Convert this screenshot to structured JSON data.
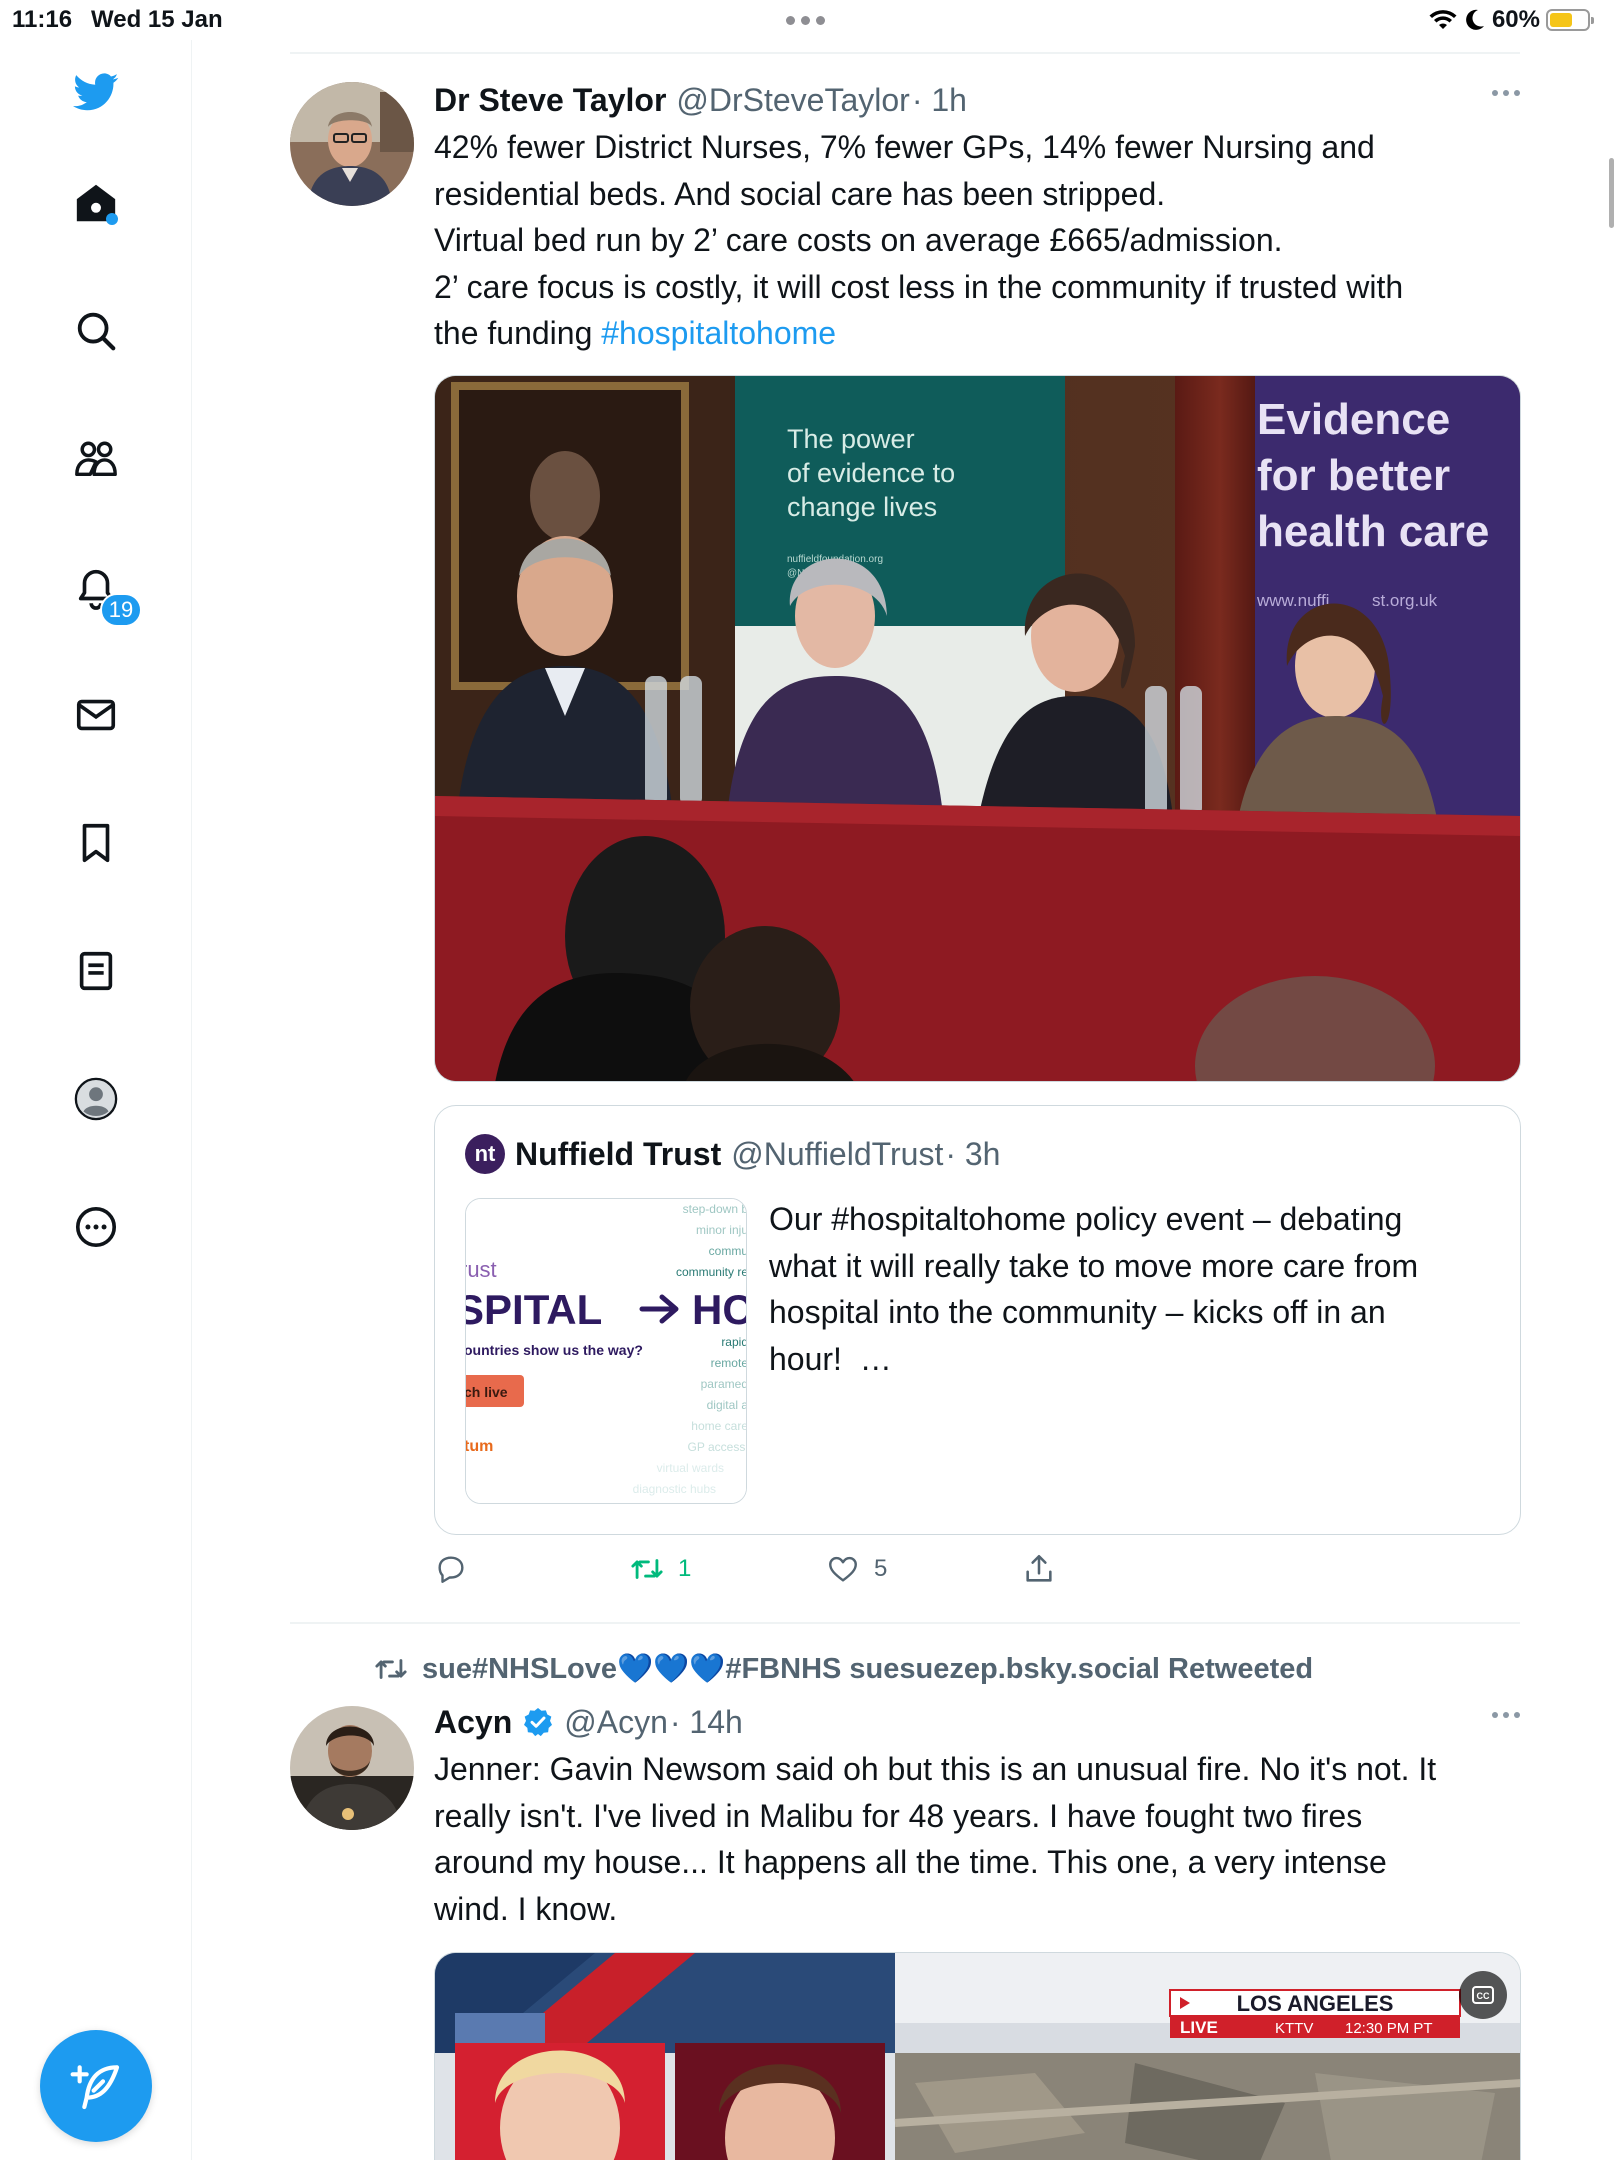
{
  "status_bar": {
    "time": "11:16",
    "date": "Wed 15 Jan",
    "battery": "60%"
  },
  "sidebar": {
    "notifications_badge": "19",
    "items": [
      "twitter-logo",
      "home",
      "search",
      "communities",
      "notifications",
      "messages",
      "bookmarks",
      "lists",
      "profile",
      "more"
    ]
  },
  "tweets": [
    {
      "name": "Dr Steve Taylor",
      "handle": "@DrSteveTaylor",
      "time": "· 1h",
      "lines": [
        "42% fewer District Nurses, 7% fewer GPs, 14% fewer Nursing and",
        "residential beds. And social care has been stripped.",
        "Virtual bed run by 2’ care costs on average £665/admission.",
        "2’ care focus is costly, it will cost less in the community if trusted with"
      ],
      "last_line_prefix": "the funding ",
      "hashtag": "#hospitaltohome",
      "media": {
        "banner_green": [
          "The power",
          "of evidence to",
          "change lives"
        ],
        "banner_green_small": [
          "nuffieldfoundation.org",
          "@NuffieldFound"
        ],
        "banner_purple": [
          "Evidence",
          "for better",
          "health care"
        ],
        "banner_purple_url": "www.nuffi         st.org.uk"
      },
      "quote": {
        "logo": "nt",
        "name": "Nuffield Trust",
        "handle": "@NuffieldTrust",
        "time": "· 3h",
        "text_lines": [
          "Our #hospitaltohome policy event – debating",
          "what it will really take to move more care from",
          "hospital into the community – kicks off in an",
          "hour!  …"
        ],
        "thumb": {
          "brand_fragment": "rust",
          "headline_left": "SPITAL",
          "headline_right": "HC",
          "subtitle": "ountries show us the way?",
          "watch_button": "ch live",
          "sponsor": "tum",
          "word_cloud_top": [
            "step-down b",
            "minor inju",
            "commu",
            "community re"
          ],
          "word_cloud_bottom": [
            "rapid",
            "remote",
            "paramed",
            "digital a",
            "home care",
            "GP accessi",
            "virtual wards",
            "diagnostic hubs"
          ]
        }
      },
      "actions": {
        "retweets": "1",
        "likes": "5"
      }
    },
    {
      "retweeted_by": "sue#NHSLove💙💙💙#FBNHS suesuezep.bsky.social Retweeted",
      "name": "Acyn",
      "handle": "@Acyn",
      "time": "· 14h",
      "lines": [
        "Jenner: Gavin Newsom said oh but this is an unusual fire. No it's not. It",
        "really isn't. I've lived in Malibu for 48 years. I have fought two fires",
        "around my house... It happens all the time. This one, a very intense",
        "wind. I know."
      ],
      "media": {
        "location": "LOS ANGELES",
        "live": "LIVE",
        "station": "KTTV",
        "timestamp": "12:30 PM PT",
        "cc": "CC"
      }
    }
  ],
  "colors": {
    "accent": "#1d9bf0",
    "text": "#0f1419",
    "secondary": "#536471",
    "retweet_green": "#00ba7c",
    "border": "#cfd9de"
  }
}
